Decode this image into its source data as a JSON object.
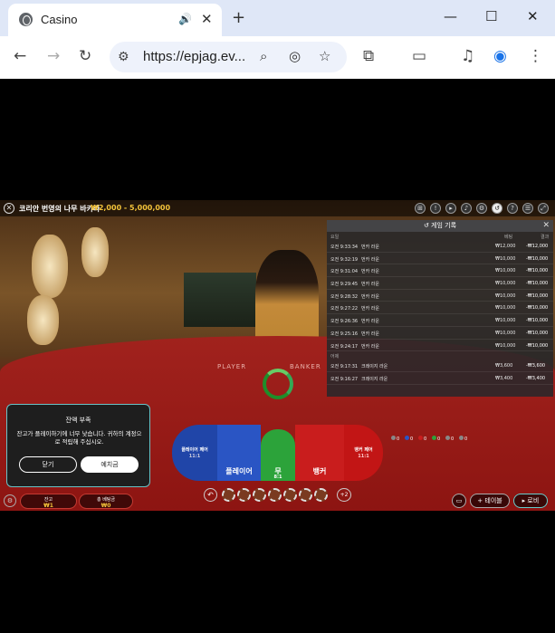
{
  "browser": {
    "tab_title": "Casino",
    "url": "https://epjag.ev...",
    "icons": [
      "speaker-icon",
      "close-tab-icon",
      "new-tab-icon",
      "minimize-icon",
      "maximize-icon",
      "close-window-icon",
      "back-icon",
      "forward-icon",
      "reload-icon",
      "site-info-icon",
      "zoom-icon",
      "eye-off-icon",
      "bookmark-star-icon",
      "extensions-icon",
      "cast-icon",
      "media-icon",
      "profile-icon",
      "menu-icon"
    ]
  },
  "game": {
    "title": "코리안 번영의 나무 바카라",
    "limit": "₩2,000 - 5,000,000",
    "table_labels": {
      "player": "PLAYER",
      "banker": "BANKER"
    }
  },
  "history": {
    "title": "게임 기록",
    "col_headers": {
      "time": "요일",
      "bet": "베팅",
      "result": "결과"
    },
    "rows": [
      {
        "time": "오전 9:33:34",
        "game": "번카 라운",
        "bet": "₩12,000",
        "result": "-₩12,000"
      },
      {
        "time": "오전 9:32:19",
        "game": "번카 라운",
        "bet": "₩10,000",
        "result": "-₩10,000"
      },
      {
        "time": "오전 9:31:04",
        "game": "번카 라운",
        "bet": "₩10,000",
        "result": "-₩10,000"
      },
      {
        "time": "오전 9:29:45",
        "game": "번카 라운",
        "bet": "₩10,000",
        "result": "-₩10,000"
      },
      {
        "time": "오전 9:28:32",
        "game": "번카 라운",
        "bet": "₩10,000",
        "result": "-₩10,000"
      },
      {
        "time": "오전 9:27:22",
        "game": "번카 라운",
        "bet": "₩10,000",
        "result": "-₩10,000"
      },
      {
        "time": "오전 9:26:36",
        "game": "번카 라운",
        "bet": "₩10,000",
        "result": "-₩10,000"
      },
      {
        "time": "오전 9:25:16",
        "game": "번카 라운",
        "bet": "₩10,000",
        "result": "-₩10,000"
      },
      {
        "time": "오전 9:24:17",
        "game": "번카 라운",
        "bet": "₩10,000",
        "result": "-₩10,000"
      }
    ],
    "section2_label": "어제",
    "rows2": [
      {
        "time": "오전 9:17:31",
        "game": "크레이지 라운",
        "bet": "₩3,600",
        "result": "-₩3,600"
      },
      {
        "time": "오전 9:16:27",
        "game": "크레이지 라운",
        "bet": "₩3,400",
        "result": "-₩3,400"
      }
    ]
  },
  "bets": {
    "player_pair": "플레이어 페어",
    "player_pair_odds": "11:1",
    "player": "플레이어",
    "tie": "무",
    "tie_odds": "8:1",
    "banker": "뱅커",
    "banker_pair": "뱅커 페어",
    "banker_pair_odds": "11:1"
  },
  "chips": [
    "",
    "",
    "",
    "",
    "",
    "",
    ""
  ],
  "plus_label": "+2",
  "stats": [
    "0",
    "0",
    "0",
    "0",
    "0",
    "0"
  ],
  "dialog": {
    "title": "잔액 부족",
    "message": "잔고가 플레이하기에 너무 낮습니다. 귀하의 계정으로 적립해 주십시오.",
    "close": "닫기",
    "deposit": "예치금"
  },
  "footer": {
    "balance_label": "잔고",
    "balance": "₩1",
    "total_bet_label": "총 베팅금",
    "total_bet": "₩0",
    "tables": "테이블",
    "lobby": "로비"
  }
}
